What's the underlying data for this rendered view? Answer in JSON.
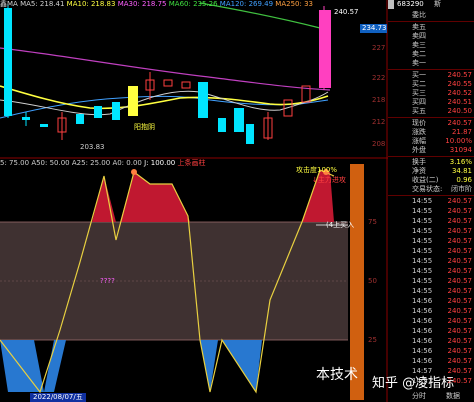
{
  "main_header": {
    "ma_label": "鑫MA",
    "ma5": "MA5: 218.41",
    "ma10": "MA10: 218.83",
    "ma30": "MA30: 218.75",
    "ma60": "MA60: 235.26",
    "ma120": "MA120: 269.49",
    "ma250": "MA250: 33"
  },
  "price_labels": {
    "high": "240.57",
    "low": "203.83",
    "right_box": "234.73",
    "candle_note": "阳抱阴"
  },
  "right_axis_main": [
    "227",
    "222",
    "218",
    "212",
    "208"
  ],
  "indicator_header": {
    "p1": "5: 75.00",
    "p2": "A50: 50.00",
    "p3": "A25: 25.00",
    "p4": "A0: 0.00",
    "p5": "J: 100.00",
    "p6": "上条画柱"
  },
  "indicator_labels": {
    "top_text": "攻击度100%",
    "buy_signal": "↓主力进攻",
    "buy_in": "(4上买入",
    "marker": "????"
  },
  "right_axis_ind": [
    "75",
    "50",
    "25"
  ],
  "watermark": "本技术",
  "zhihu": "知乎 @凌指标",
  "date_label": "2022/08/07/五",
  "side_panel": {
    "code": "683290",
    "suffix": "斯",
    "ratio_label": "委比",
    "sell": [
      {
        "label": "卖五",
        "value": ""
      },
      {
        "label": "卖四",
        "value": ""
      },
      {
        "label": "卖三",
        "value": ""
      },
      {
        "label": "卖二",
        "value": ""
      },
      {
        "label": "卖一",
        "value": ""
      }
    ],
    "buy": [
      {
        "label": "买一",
        "value": "240.57"
      },
      {
        "label": "买二",
        "value": "240.55"
      },
      {
        "label": "买三",
        "value": "240.52"
      },
      {
        "label": "买四",
        "value": "240.51"
      },
      {
        "label": "买五",
        "value": "240.50"
      }
    ],
    "stats": [
      {
        "label": "现价",
        "value": "240.57",
        "color": "#ff4040"
      },
      {
        "label": "涨跌",
        "value": "21.87",
        "color": "#ff4040"
      },
      {
        "label": "涨幅",
        "value": "10.00%",
        "color": "#ff4040"
      },
      {
        "label": "外盘",
        "value": "31094",
        "color": "#ff4040"
      },
      {
        "label": "换手",
        "value": "3.16%",
        "color": "#ffff40"
      },
      {
        "label": "净资",
        "value": "34.81",
        "color": "#ffff40"
      },
      {
        "label": "收益(二)",
        "value": "0.96",
        "color": "#ffff40"
      },
      {
        "label": "交易状态:",
        "value": "闭市阶",
        "color": "#cfcfcf"
      }
    ],
    "ticks": [
      {
        "time": "14:55",
        "price": "240.57"
      },
      {
        "time": "14:55",
        "price": "240.57"
      },
      {
        "time": "14:55",
        "price": "240.57"
      },
      {
        "time": "14:55",
        "price": "240.57"
      },
      {
        "time": "14:55",
        "price": "240.57"
      },
      {
        "time": "14:55",
        "price": "240.57"
      },
      {
        "time": "14:55",
        "price": "240.57"
      },
      {
        "time": "14:55",
        "price": "240.57"
      },
      {
        "time": "14:55",
        "price": "240.57"
      },
      {
        "time": "14:55",
        "price": "240.57"
      },
      {
        "time": "14:56",
        "price": "240.57"
      },
      {
        "time": "14:56",
        "price": "240.57"
      },
      {
        "time": "14:56",
        "price": "240.57"
      },
      {
        "time": "14:56",
        "price": "240.57"
      },
      {
        "time": "14:56",
        "price": "240.57"
      },
      {
        "time": "14:56",
        "price": "240.57"
      },
      {
        "time": "14:56",
        "price": "240.57"
      },
      {
        "time": "14:57",
        "price": "240.57"
      },
      {
        "time": "14:57",
        "price": "240.57"
      }
    ],
    "footer_left": "分时",
    "footer_right": "数据"
  }
}
